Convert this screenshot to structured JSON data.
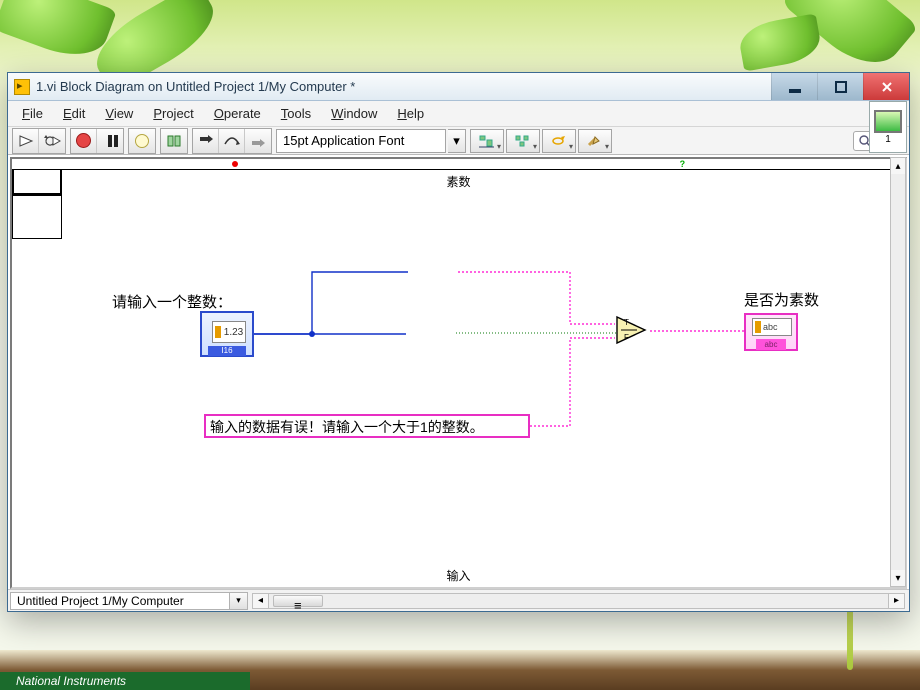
{
  "window": {
    "title": "1.vi Block Diagram on Untitled Project 1/My Computer *"
  },
  "menu": {
    "file": "File",
    "edit": "Edit",
    "view": "View",
    "project": "Project",
    "operate": "Operate",
    "tools": "Tools",
    "window": "Window",
    "help": "Help"
  },
  "toolbar": {
    "font": "15pt Application Font",
    "icon_index": "1"
  },
  "diagram": {
    "input_label": "请输入一个整数：",
    "output_label": "是否为素数",
    "input_ctrl_text": "1.23",
    "input_ctrl_type": "I16",
    "case_prime": "素数",
    "case_input": "输入",
    "case_question": "?",
    "indicator_text": "abc",
    "indicator_type": "abc",
    "error_constant": "输入的数据有误！请输入一个大于1的整数。"
  },
  "statusbar": {
    "path": "Untitled Project 1/My Computer"
  },
  "footer": {
    "company": "National Instruments"
  }
}
